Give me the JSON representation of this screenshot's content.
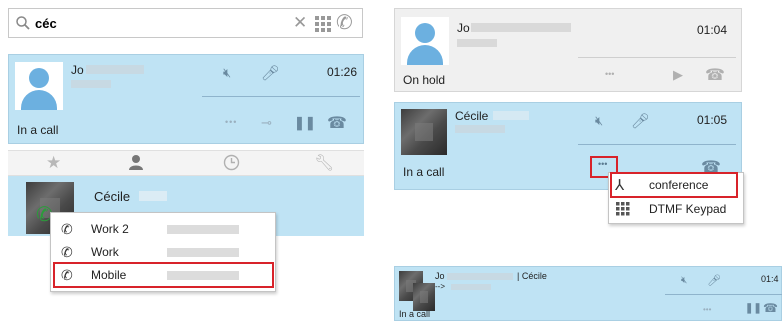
{
  "left_panel": {
    "search": {
      "value": "céc",
      "clear_icon": "close-icon",
      "dialpad_icon": "dialpad-icon",
      "call_icon": "phone-icon"
    },
    "active_call": {
      "contact": "Jo",
      "time": "01:26",
      "status": "In a call",
      "more": "•••"
    },
    "tabs": [
      {
        "name": "favorites-tab",
        "icon": "★"
      },
      {
        "name": "contacts-tab",
        "icon": "user"
      },
      {
        "name": "history-tab",
        "icon": "clock"
      },
      {
        "name": "settings-tab",
        "icon": "wrench"
      }
    ],
    "contact_result": {
      "name": "Cécile"
    },
    "number_menu": [
      {
        "label": "Work 2"
      },
      {
        "label": "Work"
      },
      {
        "label": "Mobile"
      }
    ]
  },
  "right_panel": {
    "held_call": {
      "contact": "Jo",
      "time": "01:04",
      "status": "On hold",
      "more": "•••"
    },
    "second_call": {
      "contact": "Cécile",
      "time": "01:05",
      "status": "In a call",
      "more": "•••"
    },
    "more_menu": [
      {
        "label": "conference",
        "icon": "merge-icon"
      },
      {
        "label": "DTMF Keypad",
        "icon": "keypad-icon"
      }
    ]
  },
  "conference_panel": {
    "contacts": "Jo",
    "separator": "| Cécile",
    "arrow": "-->",
    "time": "01:4",
    "status": "In a call",
    "more": "•••"
  },
  "colors": {
    "call_bg": "#bfe3f4",
    "hold_bg": "#f0f0f0",
    "highlight": "#d8232a",
    "icon": "#6a8aa0"
  }
}
